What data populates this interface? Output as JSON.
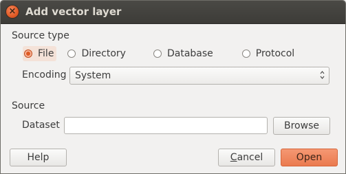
{
  "window": {
    "title": "Add vector layer"
  },
  "source_type": {
    "label": "Source type",
    "options": [
      {
        "label": "File",
        "selected": true
      },
      {
        "label": "Directory",
        "selected": false
      },
      {
        "label": "Database",
        "selected": false
      },
      {
        "label": "Protocol",
        "selected": false
      }
    ]
  },
  "encoding": {
    "label": "Encoding",
    "value": "System"
  },
  "source": {
    "label": "Source",
    "dataset_label": "Dataset",
    "dataset_value": "",
    "browse_label": "Browse"
  },
  "buttons": {
    "help": "Help",
    "cancel_mnemonic": "C",
    "cancel_rest": "ancel",
    "open": "Open"
  },
  "colors": {
    "titlebar": "#3d3c38",
    "close_button": "#e05a25",
    "accent": "#ea7a4f",
    "background": "#f2f1f0"
  }
}
